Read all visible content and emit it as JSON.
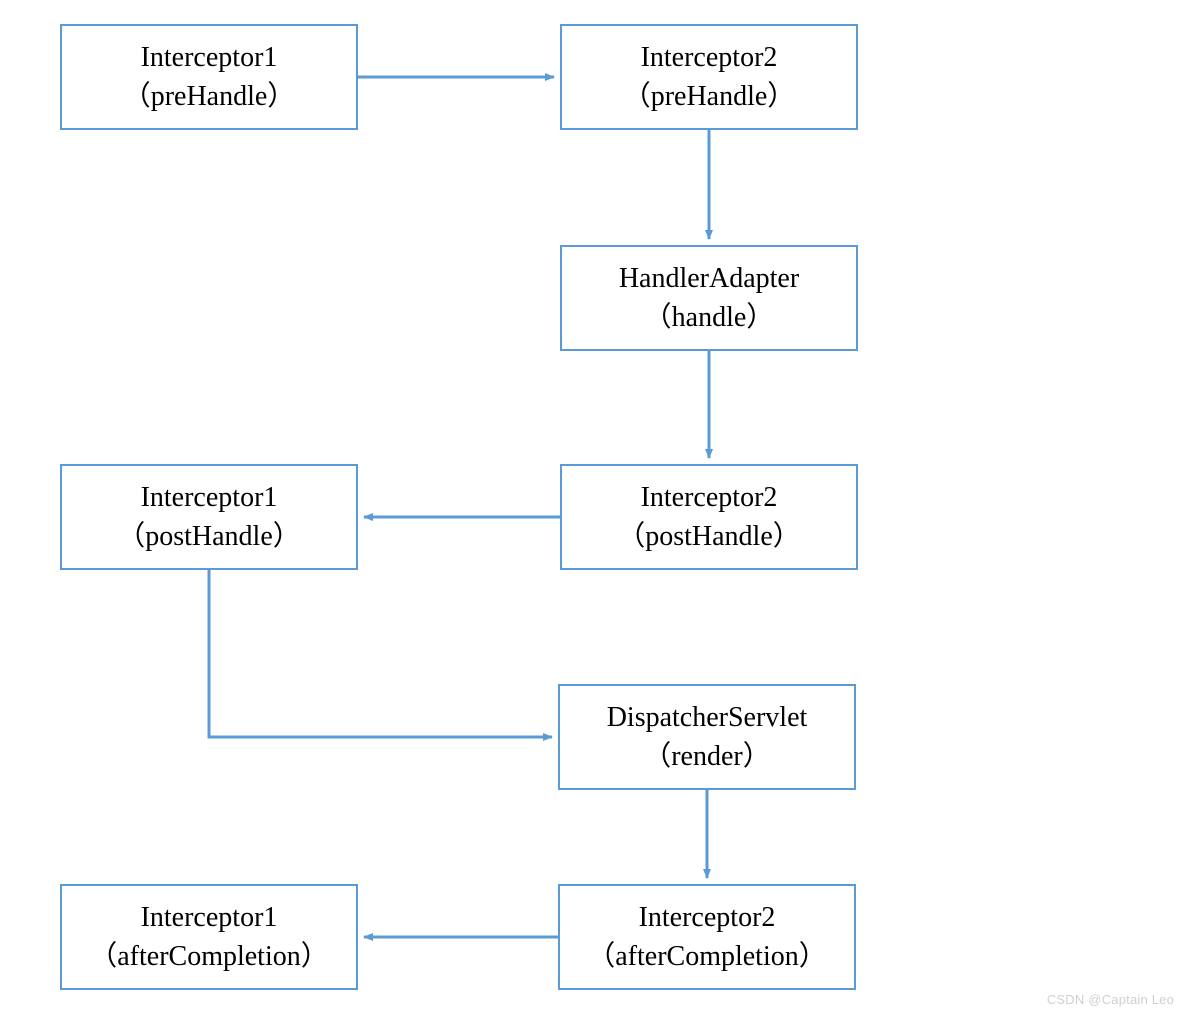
{
  "boxes": {
    "b1": {
      "title": "Interceptor1",
      "sub": "（preHandle）"
    },
    "b2": {
      "title": "Interceptor2",
      "sub": "（preHandle）"
    },
    "b3": {
      "title": "HandlerAdapter",
      "sub": "（handle）"
    },
    "b4": {
      "title": "Interceptor2",
      "sub": "（postHandle）"
    },
    "b5": {
      "title": "Interceptor1",
      "sub": "（postHandle）"
    },
    "b6": {
      "title": "DispatcherServlet",
      "sub": "（render）"
    },
    "b7": {
      "title": "Interceptor2",
      "sub": "（afterCompletion）"
    },
    "b8": {
      "title": "Interceptor1",
      "sub": "（afterCompletion）"
    }
  },
  "watermark": "CSDN @Captain Leo",
  "colors": {
    "stroke": "#5b9bd5"
  }
}
